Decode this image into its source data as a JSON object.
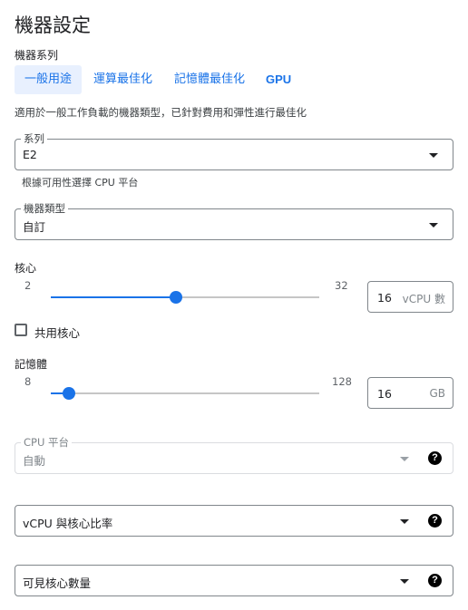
{
  "page_title": "機器設定",
  "machine_family": {
    "label": "機器系列",
    "tabs": [
      "一般用途",
      "運算最佳化",
      "記憶體最佳化",
      "GPU"
    ],
    "description": "適用於一般工作負載的機器類型，已針對費用和彈性進行最佳化"
  },
  "series": {
    "label": "系列",
    "value": "E2",
    "help": "根據可用性選擇 CPU 平台"
  },
  "machine_type": {
    "label": "機器類型",
    "value": "自訂"
  },
  "cores": {
    "label": "核心",
    "min": "2",
    "max": "32",
    "value": "16",
    "unit": "vCPU 數",
    "level": 0.467
  },
  "shared_core": {
    "label": "共用核心",
    "checked": false
  },
  "memory": {
    "label": "記憶體",
    "min": "8",
    "max": "128",
    "value": "16",
    "unit": "GB",
    "level": 0.067
  },
  "cpu_platform": {
    "label": "CPU 平台",
    "value": "自動"
  },
  "vcpu_ratio": {
    "label": "vCPU 與核心比率"
  },
  "visible_cores": {
    "label": "可見核心數量"
  },
  "colors": {
    "accent": "#1a73e8",
    "tab_active_bg": "#e8f0fe"
  },
  "icons": [
    "dropdown-arrow-icon",
    "help-icon",
    "checkbox-icon"
  ]
}
